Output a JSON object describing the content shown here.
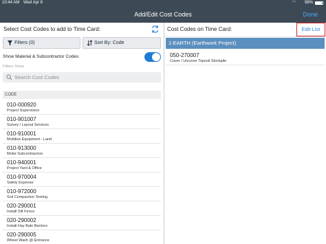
{
  "status_bar": {
    "time": "10:44 AM",
    "date": "Wed Apr 8",
    "battery": "98%"
  },
  "nav": {
    "title": "Add/Edit Cost Codes",
    "done_label": "Done"
  },
  "left": {
    "heading": "Select Cost Codes to add to Time Card:",
    "filters_label": "Filters (0)",
    "sort_label": "Sort By: Code",
    "show_material_label": "Show Material & Subcontractor Codes",
    "show_material_on": true,
    "filters_status": "Filters: None",
    "search_placeholder": "Search Cost Codes",
    "column_header": "CODE",
    "rows": [
      {
        "code": "010-000920",
        "desc": "Project Supervision"
      },
      {
        "code": "010-901007",
        "desc": "Survey / Layout Services"
      },
      {
        "code": "010-910001",
        "desc": "Mobilize Equipment - Land"
      },
      {
        "code": "010-913000",
        "desc": "Mobe Subcontractors"
      },
      {
        "code": "010-940001",
        "desc": "Project Yard & Office"
      },
      {
        "code": "010-970004",
        "desc": "Safety Expense"
      },
      {
        "code": "010-972000",
        "desc": "Soil Compaction Testing"
      },
      {
        "code": "020-290001",
        "desc": "Install Silt Fence"
      },
      {
        "code": "020-290002",
        "desc": "Install Hay Bale Barriers"
      },
      {
        "code": "020-290005",
        "desc": "Wheel Wash @ Entrance"
      }
    ]
  },
  "right": {
    "heading": "Cost Codes on Time Card:",
    "edit_label": "Edit List",
    "group_title": "1-EARTH (Earthwork Project)",
    "items": [
      {
        "code": "050-270007",
        "desc": "Cover / Uncover Topsoil Stockpile"
      }
    ]
  },
  "colors": {
    "nav_bg": "#3d4a56",
    "accent": "#1e7bd6",
    "group_bg": "#5b8fbf",
    "highlight": "#d4232b"
  },
  "icons": [
    "wifi-icon",
    "battery-icon",
    "refresh-icon",
    "filter-icon",
    "sort-icon",
    "search-icon"
  ]
}
